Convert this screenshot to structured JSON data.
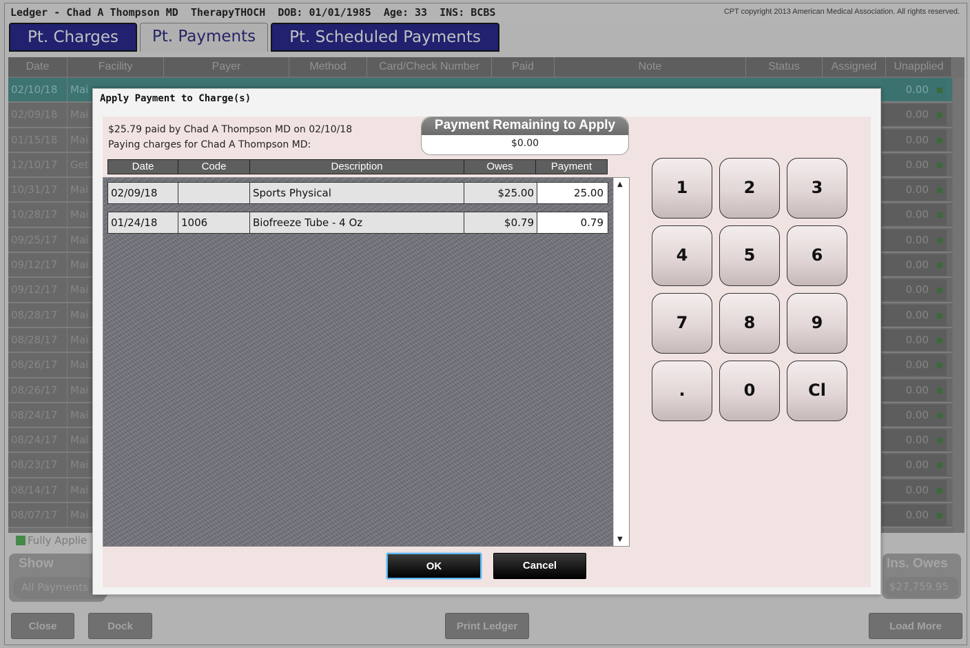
{
  "titlebar": {
    "title": "Ledger - Chad A Thompson MD  TherapyTHOCH  DOB: 01/01/1985  Age: 33  INS: BCBS",
    "copyright": "CPT copyright 2013 American Medical Association. All rights reserved."
  },
  "tabs": [
    {
      "label": "Pt. Charges",
      "active": false
    },
    {
      "label": "Pt. Payments",
      "active": true
    },
    {
      "label": "Pt. Scheduled Payments",
      "active": false
    }
  ],
  "grid": {
    "columns": [
      "Date",
      "Facility",
      "Payer",
      "Method",
      "Card/Check Number",
      "Paid",
      "Note",
      "Status",
      "Assigned",
      "Unapplied"
    ],
    "rows": [
      {
        "date": "02/10/18",
        "facility": "Mai",
        "unapplied": "0.00",
        "selected": true
      },
      {
        "date": "02/09/18",
        "facility": "Mai",
        "unapplied": "0.00"
      },
      {
        "date": "01/15/18",
        "facility": "Mai",
        "unapplied": "0.00"
      },
      {
        "date": "12/10/17",
        "facility": "Get",
        "unapplied": "0.00"
      },
      {
        "date": "10/31/17",
        "facility": "Mai",
        "unapplied": "0.00"
      },
      {
        "date": "10/28/17",
        "facility": "Mai",
        "unapplied": "0.00"
      },
      {
        "date": "09/25/17",
        "facility": "Mai",
        "unapplied": "0.00"
      },
      {
        "date": "09/12/17",
        "facility": "Mai",
        "unapplied": "0.00"
      },
      {
        "date": "09/12/17",
        "facility": "Mai",
        "unapplied": "0.00"
      },
      {
        "date": "08/28/17",
        "facility": "Mai",
        "unapplied": "0.00"
      },
      {
        "date": "08/28/17",
        "facility": "Mai",
        "unapplied": "0.00"
      },
      {
        "date": "08/26/17",
        "facility": "Mai",
        "unapplied": "0.00"
      },
      {
        "date": "08/26/17",
        "facility": "Mai",
        "unapplied": "0.00"
      },
      {
        "date": "08/24/17",
        "facility": "Mai",
        "unapplied": "0.00"
      },
      {
        "date": "08/24/17",
        "facility": "Mai",
        "unapplied": "0.00"
      },
      {
        "date": "08/23/17",
        "facility": "Mai",
        "unapplied": "0.00"
      },
      {
        "date": "08/14/17",
        "facility": "Mai",
        "unapplied": "0.00"
      },
      {
        "date": "08/07/17",
        "facility": "Mai",
        "unapplied": "0.00"
      }
    ]
  },
  "legend": {
    "label": "Fully Applie",
    "color": "#4caf50"
  },
  "show": {
    "label": "Show",
    "value": "All Payments"
  },
  "ins_owes": {
    "label": "Ins. Owes",
    "value": "$27,759.95"
  },
  "bottom_buttons": {
    "close": "Close",
    "dock": "Dock",
    "print": "Print Ledger",
    "load_more": "Load More"
  },
  "dialog": {
    "title": "Apply Payment to Charge(s)",
    "paid_line": "$25.79 paid by Chad A Thompson MD on 02/10/18",
    "paying_line": "Paying charges for Chad A Thompson MD:",
    "remaining_label": "Payment Remaining to Apply",
    "remaining_value": "$0.00",
    "columns": [
      "Date",
      "Code",
      "Description",
      "Owes",
      "Payment"
    ],
    "charges": [
      {
        "date": "02/09/18",
        "code": "",
        "description": "Sports Physical",
        "owes": "$25.00",
        "payment": "25.00"
      },
      {
        "date": "01/24/18",
        "code": "1006",
        "description": "Biofreeze Tube - 4 Oz",
        "owes": "$0.79",
        "payment": "0.79"
      }
    ],
    "keypad": [
      "1",
      "2",
      "3",
      "4",
      "5",
      "6",
      "7",
      "8",
      "9",
      ".",
      "0",
      "Cl"
    ],
    "ok_label": "OK",
    "cancel_label": "Cancel"
  }
}
